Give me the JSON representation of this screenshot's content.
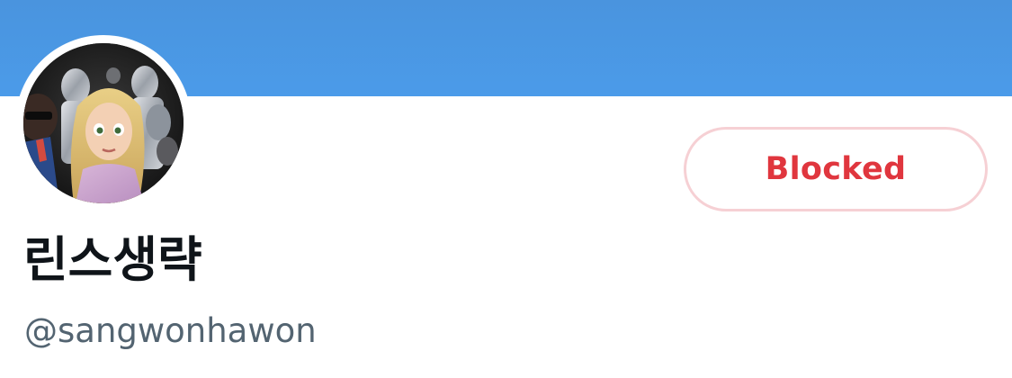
{
  "profile": {
    "display_name": "린스생략",
    "handle": "@sangwonhawon",
    "avatar_icon": "profile-avatar-image",
    "banner_color": "#4a96e2"
  },
  "actions": {
    "blocked_label": "Blocked",
    "blocked_color": "#e0363e"
  }
}
